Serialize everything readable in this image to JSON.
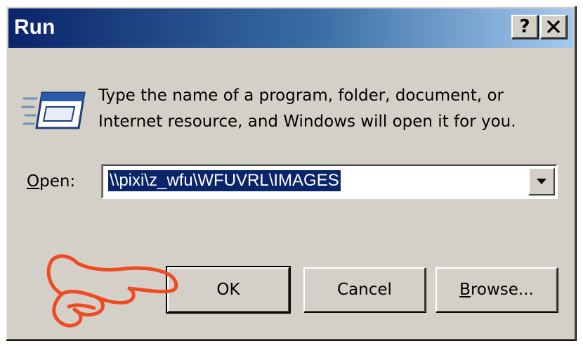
{
  "window": {
    "title": "Run",
    "help_label": "?",
    "close_icon": "close-icon"
  },
  "message": {
    "line1": "Type the name of a program, folder, document, or",
    "line2": "Internet resource, and Windows will open it for you."
  },
  "open_field": {
    "label_accel": "O",
    "label_rest": "pen:",
    "value": "\\\\pixi\\z_wfu\\WFUVRL\\IMAGES"
  },
  "buttons": {
    "ok": "OK",
    "cancel": "Cancel",
    "browse_accel": "B",
    "browse_rest": "rowse..."
  },
  "icons": {
    "run": "run-icon",
    "dropdown": "chevron-down-icon",
    "annotation": "pointing-hand-icon"
  },
  "colors": {
    "title_start": "#0a246a",
    "title_end": "#a6caf0",
    "dialog_bg": "#d4d0c8",
    "selection": "#0a246a",
    "hand_annotation": "#ef4b23"
  }
}
